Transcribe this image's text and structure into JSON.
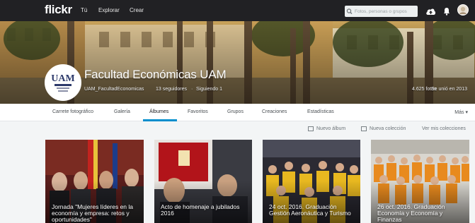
{
  "nav": {
    "logo": "flickr",
    "links": [
      "Tú",
      "Explorar",
      "Crear"
    ],
    "search_placeholder": "Fotos, personas o grupos"
  },
  "profile": {
    "name": "Facultad Económicas UAM",
    "username": "UAM_FacultadEconomicas",
    "followers": "13 seguidores",
    "following": "Siguiendo 1",
    "photos": "4.625 fotos",
    "joined": "Se unió en 2013",
    "avatar_text": "UAM"
  },
  "tabs": [
    "Carrete fotográfico",
    "Galería",
    "Álbumes",
    "Favoritos",
    "Grupos",
    "Creaciones",
    "Estadísticas"
  ],
  "active_tab": "Álbumes",
  "more_label": "Más",
  "actions": {
    "new_album": "Nuevo álbum",
    "new_collection": "Nueva colección",
    "view_collections": "Ver mis colecciones"
  },
  "albums": [
    {
      "title": "Jornada \"Mujeres líderes en la economía y empresa: retos y oportunidades\""
    },
    {
      "title": "Acto de homenaje a jubilados 2016"
    },
    {
      "title": "24 oct. 2016. Graduación Gestión Aeronáutica y Turismo"
    },
    {
      "title": "26 oct. 2016. Graduación Economía y Economía y Finanzas"
    }
  ],
  "colors": {
    "nav_bg": "#212124",
    "accent": "#008ecd",
    "page_bg": "#f3f5f6"
  }
}
